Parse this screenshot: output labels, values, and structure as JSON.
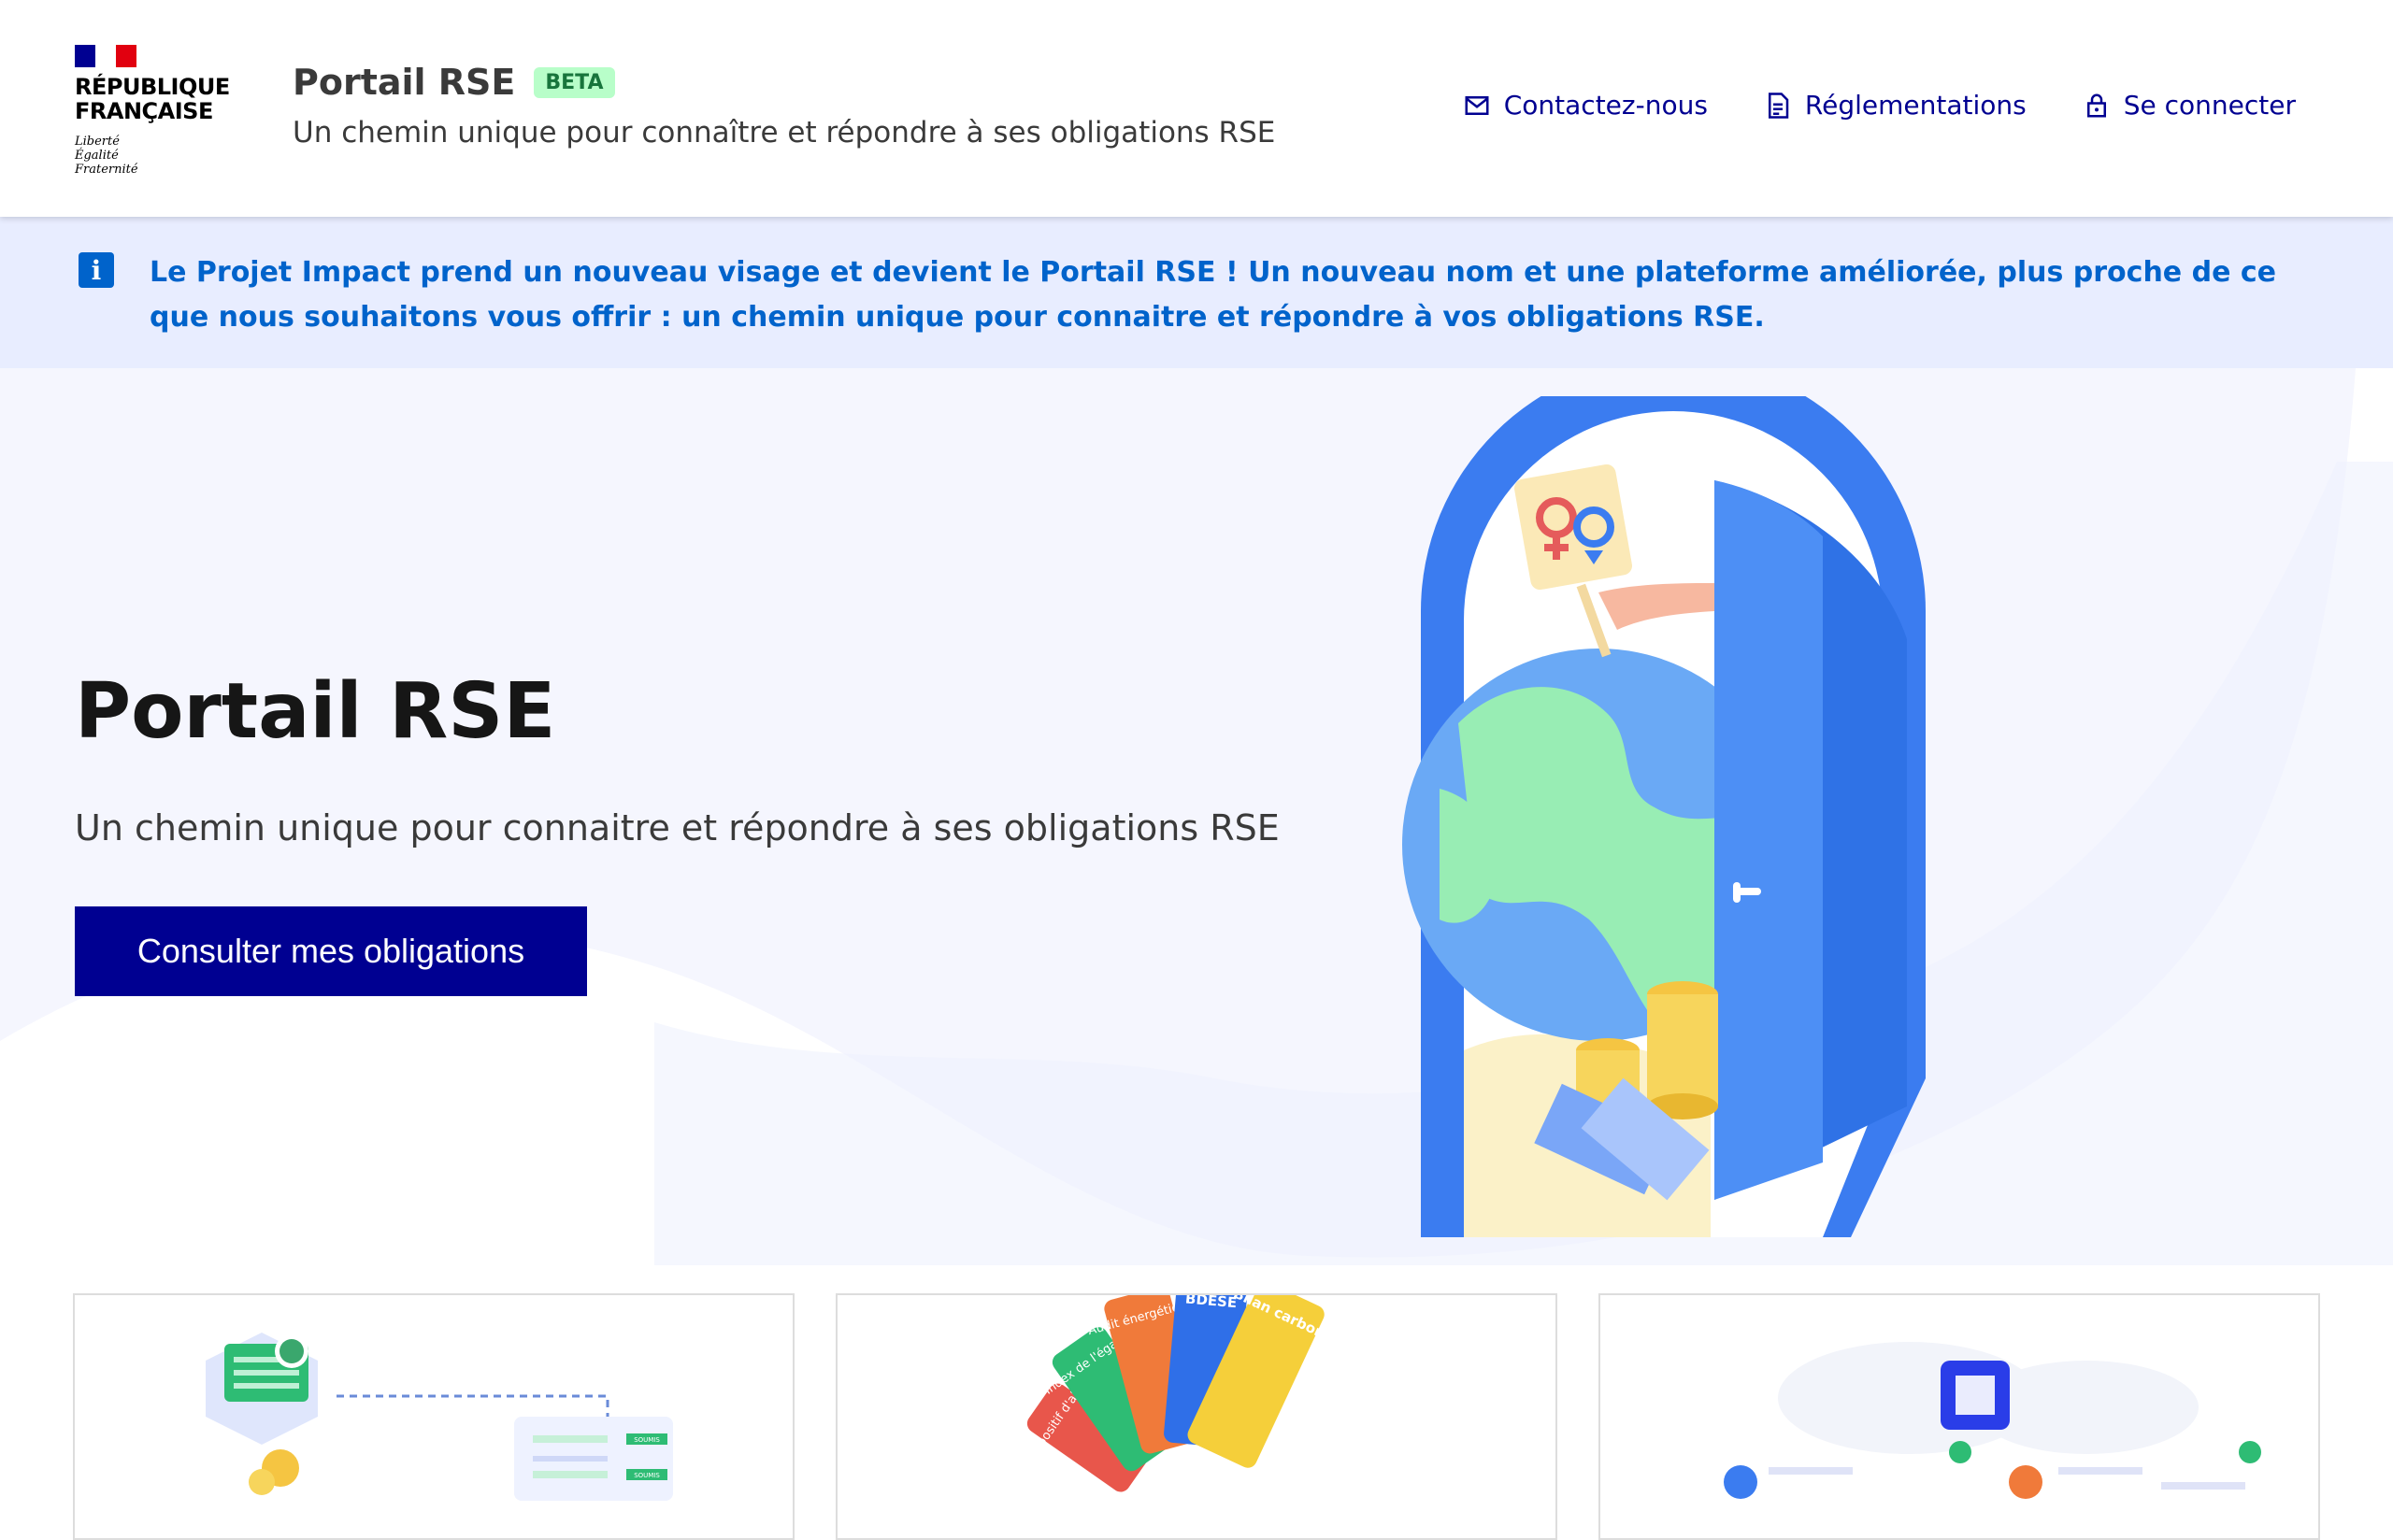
{
  "header": {
    "logo": {
      "line1": "RÉPUBLIQUE",
      "line2": "FRANÇAISE",
      "motto1": "Liberté",
      "motto2": "Égalité",
      "motto3": "Fraternité"
    },
    "site_name": "Portail RSE",
    "badge": "BETA",
    "tagline": "Un chemin unique pour connaître et répondre à ses obligations RSE",
    "nav": [
      {
        "label": "Contactez-nous",
        "icon": "mail-icon"
      },
      {
        "label": "Réglementations",
        "icon": "document-icon"
      },
      {
        "label": "Se connecter",
        "icon": "lock-icon"
      }
    ]
  },
  "notice": {
    "icon": "info-icon",
    "text": "Le Projet Impact prend un nouveau visage et devient le Portail RSE ! Un nouveau nom et une plateforme améliorée, plus proche de ce que nous souhaitons vous offrir : un chemin unique pour connaitre et répondre à vos obligations RSE."
  },
  "hero": {
    "title": "Portail RSE",
    "subtitle": "Un chemin unique pour connaitre et répondre à ses obligations RSE",
    "cta": "Consulter mes obligations"
  },
  "cards": {
    "card1": {
      "status1": "SOUMIS",
      "status2": "SOUMIS"
    },
    "card2": {
      "cards": [
        "Dispositif d'alerte",
        "Index de l'égalité",
        "Audit énergétique",
        "BDESE",
        "Bilan carbone"
      ]
    }
  },
  "colors": {
    "primary": "#000091",
    "info": "#0063cb",
    "notice_bg": "#e8edff",
    "hero_bg": "#f5f6fe",
    "beta_bg": "#b8fec9",
    "beta_text": "#18753c"
  }
}
